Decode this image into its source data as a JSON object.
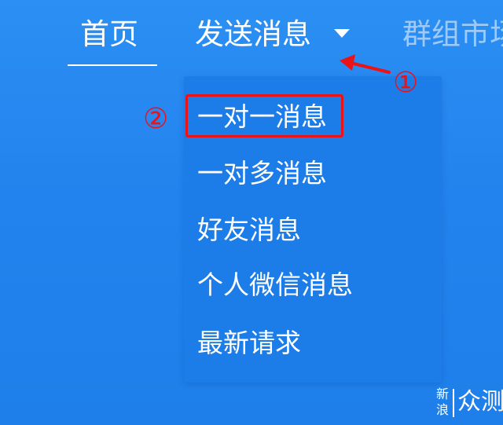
{
  "nav": {
    "home_label": "首页",
    "send_label": "发送消息",
    "group_label": "群组市场"
  },
  "dropdown": {
    "items": [
      {
        "label": "一对一消息"
      },
      {
        "label": "一对多消息"
      },
      {
        "label": "好友消息"
      },
      {
        "label": "个人微信消息"
      },
      {
        "label": "最新请求"
      }
    ]
  },
  "annotations": {
    "step1": "①",
    "step2": "②",
    "color": "#e8141a"
  },
  "watermark": {
    "char_top": "新",
    "char_bottom": "浪",
    "brand": "众测"
  },
  "colors": {
    "background": "#2383ee",
    "dropdown": "#1c7ce8",
    "text": "#ffffff"
  },
  "icons": {
    "caret": "caret-down-icon",
    "arrow": "annotation-arrow-icon"
  }
}
